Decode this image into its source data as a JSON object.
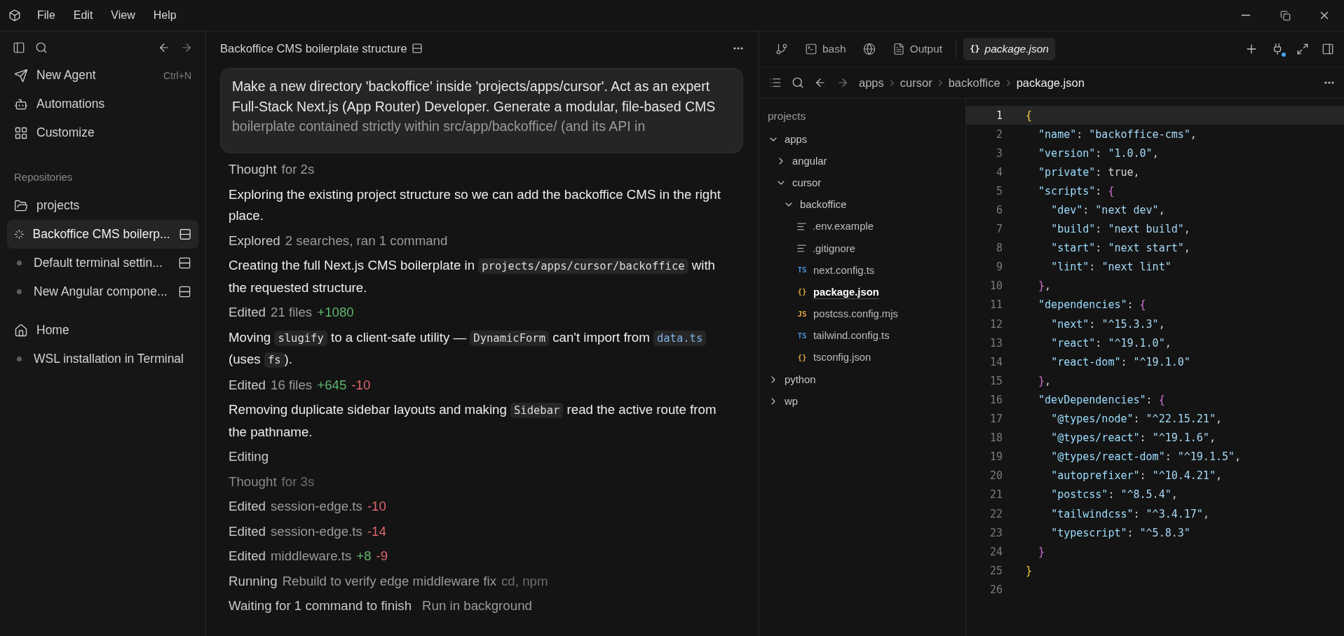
{
  "menu": [
    "File",
    "Edit",
    "View",
    "Help"
  ],
  "sidebar": {
    "actions": [
      {
        "label": "New Agent",
        "shortcut": "Ctrl+N"
      },
      {
        "label": "Automations"
      },
      {
        "label": "Customize"
      }
    ],
    "repositories": {
      "heading": "Repositories",
      "project": "projects",
      "chats": [
        {
          "title": "Backoffice CMS boilerp...",
          "selected": true,
          "running": true
        },
        {
          "title": "Default terminal settin...",
          "selected": false,
          "running": false
        },
        {
          "title": "New Angular compone...",
          "selected": false,
          "running": false
        }
      ]
    },
    "home": {
      "label": "Home",
      "chats": [
        {
          "title": "WSL installation in Terminal",
          "selected": false,
          "running": false
        }
      ]
    }
  },
  "chat": {
    "title": "Backoffice CMS boilerplate structure",
    "prompt": {
      "lines": [
        "Make a new directory 'backoffice' inside 'projects/apps/cursor'. Act as an expert",
        "Full-Stack Next.js (App Router) Developer. Generate a modular, file-based CMS",
        "boilerplate contained strictly within src/app/backoffice/ (and its API in"
      ]
    },
    "items": [
      {
        "kind": "status",
        "label": "Thought",
        "detail": "for 2s"
      },
      {
        "kind": "paragraph",
        "segments": [
          {
            "kind": "text",
            "text": "Exploring the existing project structure so we can add the backoffice CMS in the right place."
          }
        ]
      },
      {
        "kind": "status",
        "label": "Explored",
        "detail": "2 searches, ran 1 command"
      },
      {
        "kind": "paragraph",
        "segments": [
          {
            "kind": "text",
            "text": "Creating the full Next.js CMS boilerplate in "
          },
          {
            "kind": "code",
            "text": "projects/apps/cursor/backoffice"
          },
          {
            "kind": "text",
            "text": " with the requested structure."
          }
        ]
      },
      {
        "kind": "status",
        "label": "Edited",
        "detail": "21 files",
        "added": "+1080"
      },
      {
        "kind": "paragraph",
        "segments": [
          {
            "kind": "text",
            "text": "Moving "
          },
          {
            "kind": "code",
            "text": "slugify"
          },
          {
            "kind": "text",
            "text": " to a client-safe utility — "
          },
          {
            "kind": "code",
            "text": "DynamicForm"
          },
          {
            "kind": "text",
            "text": " can't import from "
          },
          {
            "kind": "link",
            "text": "data.ts"
          },
          {
            "kind": "text",
            "text": " (uses "
          },
          {
            "kind": "code",
            "text": "fs"
          },
          {
            "kind": "text",
            "text": ")."
          }
        ]
      },
      {
        "kind": "status",
        "label": "Edited",
        "detail": "16 files",
        "added": "+645",
        "removed": "-10"
      },
      {
        "kind": "paragraph",
        "segments": [
          {
            "kind": "text",
            "text": "Removing duplicate sidebar layouts and making "
          },
          {
            "kind": "code",
            "text": "Sidebar"
          },
          {
            "kind": "text",
            "text": " read the active route from the pathname."
          }
        ]
      },
      {
        "kind": "status",
        "label": "Editing"
      },
      {
        "kind": "status",
        "label": "Thought",
        "detail": "for 3s",
        "faded": true
      },
      {
        "kind": "status",
        "label": "Edited",
        "detail": "session-edge.ts",
        "removed": "-10"
      },
      {
        "kind": "status",
        "label": "Edited",
        "detail": "session-edge.ts",
        "removed": "-14"
      },
      {
        "kind": "status",
        "label": "Edited",
        "detail": "middleware.ts",
        "added": "+8",
        "removed": "-9"
      },
      {
        "kind": "status",
        "label": "Running",
        "detail": "Rebuild to verify edge middleware fix",
        "note": "cd, npm"
      },
      {
        "kind": "status",
        "label": "Waiting for 1 command to finish",
        "action": "Run in background"
      }
    ]
  },
  "editor": {
    "tabs": [
      {
        "kind": "branch",
        "selected": false
      },
      {
        "kind": "terminal",
        "label": "bash",
        "selected": false
      },
      {
        "kind": "browser",
        "selected": false
      },
      {
        "kind": "output",
        "label": "Output",
        "selected": false
      },
      {
        "kind": "file",
        "badge": "{}",
        "label": "package.json",
        "selected": true
      }
    ],
    "breadcrumb": [
      "apps",
      "cursor",
      "backoffice",
      "package.json"
    ],
    "tree": {
      "root": "projects",
      "items": [
        {
          "kind": "folder",
          "label": "apps",
          "expanded": true,
          "children": [
            {
              "kind": "folder",
              "label": "angular",
              "expanded": false
            },
            {
              "kind": "folder",
              "label": "cursor",
              "expanded": true,
              "children": [
                {
                  "kind": "folder",
                  "label": "backoffice",
                  "expanded": true,
                  "children": [
                    {
                      "kind": "text",
                      "label": ".env.example",
                      "selected": false
                    },
                    {
                      "kind": "text",
                      "label": ".gitignore",
                      "selected": false
                    },
                    {
                      "kind": "badge",
                      "badge": "TS",
                      "color": "#4b8fd6",
                      "label": "next.config.ts",
                      "selected": false
                    },
                    {
                      "kind": "badge",
                      "badge": "{}",
                      "color": "#d9a441",
                      "label": "package.json",
                      "selected": true
                    },
                    {
                      "kind": "badge",
                      "badge": "JS",
                      "color": "#e8a33c",
                      "label": "postcss.config.mjs",
                      "selected": false
                    },
                    {
                      "kind": "badge",
                      "badge": "TS",
                      "color": "#4b8fd6",
                      "label": "tailwind.config.ts",
                      "selected": false
                    },
                    {
                      "kind": "badge",
                      "badge": "{}",
                      "color": "#d9a441",
                      "label": "tsconfig.json",
                      "selected": false
                    }
                  ]
                }
              ]
            }
          ]
        },
        {
          "kind": "folder",
          "label": "python",
          "expanded": false
        },
        {
          "kind": "folder",
          "label": "wp",
          "expanded": false
        }
      ]
    },
    "code": [
      {
        "number": "1",
        "text": "{",
        "current": true
      },
      {
        "number": "2",
        "text": "  \"name\": \"backoffice-cms\",",
        "current": false
      },
      {
        "number": "3",
        "text": "  \"version\": \"1.0.0\",",
        "current": false
      },
      {
        "number": "4",
        "text": "  \"private\": true,",
        "current": false
      },
      {
        "number": "5",
        "text": "  \"scripts\": {",
        "current": false
      },
      {
        "number": "6",
        "text": "    \"dev\": \"next dev\",",
        "current": false
      },
      {
        "number": "7",
        "text": "    \"build\": \"next build\",",
        "current": false
      },
      {
        "number": "8",
        "text": "    \"start\": \"next start\",",
        "current": false
      },
      {
        "number": "9",
        "text": "    \"lint\": \"next lint\"",
        "current": false
      },
      {
        "number": "10",
        "text": "  },",
        "current": false
      },
      {
        "number": "11",
        "text": "  \"dependencies\": {",
        "current": false
      },
      {
        "number": "12",
        "text": "    \"next\": \"^15.3.3\",",
        "current": false
      },
      {
        "number": "13",
        "text": "    \"react\": \"^19.1.0\",",
        "current": false
      },
      {
        "number": "14",
        "text": "    \"react-dom\": \"^19.1.0\"",
        "current": false
      },
      {
        "number": "15",
        "text": "  },",
        "current": false
      },
      {
        "number": "16",
        "text": "  \"devDependencies\": {",
        "current": false
      },
      {
        "number": "17",
        "text": "    \"@types/node\": \"^22.15.21\",",
        "current": false
      },
      {
        "number": "18",
        "text": "    \"@types/react\": \"^19.1.6\",",
        "current": false
      },
      {
        "number": "19",
        "text": "    \"@types/react-dom\": \"^19.1.5\",",
        "current": false
      },
      {
        "number": "20",
        "text": "    \"autoprefixer\": \"^10.4.21\",",
        "current": false
      },
      {
        "number": "21",
        "text": "    \"postcss\": \"^8.5.4\",",
        "current": false
      },
      {
        "number": "22",
        "text": "    \"tailwindcss\": \"^3.4.17\",",
        "current": false
      },
      {
        "number": "23",
        "text": "    \"typescript\": \"^5.8.3\"",
        "current": false
      },
      {
        "number": "24",
        "text": "  }",
        "current": false
      },
      {
        "number": "25",
        "text": "}",
        "current": false
      },
      {
        "number": "26",
        "current": false
      }
    ]
  }
}
